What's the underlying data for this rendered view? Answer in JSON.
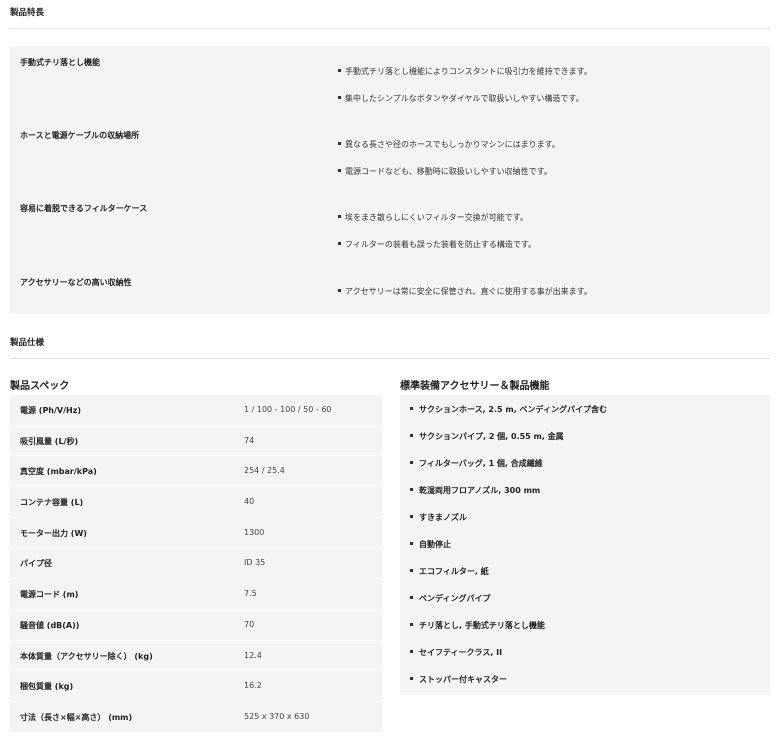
{
  "features_section": {
    "title": "製品特長",
    "items": [
      {
        "name": "手動式チリ落とし機能",
        "bullets": [
          "手動式チリ落とし機能によりコンスタントに吸引力を維持できます。",
          "集中したシンプルなボタンやダイヤルで取扱いしやすい構造です。"
        ]
      },
      {
        "name": "ホースと電源ケーブルの収納場所",
        "bullets": [
          "異なる長さや径のホースでもしっかりマシンにはまります。",
          "電源コードなども、移動時に取扱いしやすい収納性です。"
        ]
      },
      {
        "name": "容易に着脱できるフィルターケース",
        "bullets": [
          "埃をまき散らしにくいフィルター交換が可能です。",
          "フィルターの装着も誤った装着を防止する構造です。"
        ]
      },
      {
        "name": "アクセサリーなどの高い収納性",
        "bullets": [
          "アクセサリーは常に安全に保管され、直ぐに使用する事が出来ます。"
        ]
      }
    ]
  },
  "specs_section": {
    "title": "製品仕様",
    "spec_heading": "製品スペック",
    "rows": [
      {
        "label": "電源 (Ph/V/Hz)",
        "value": "1 / 100 - 100 / 50 - 60"
      },
      {
        "label": "吸引風量 (L/秒)",
        "value": "74"
      },
      {
        "label": "真空度 (mbar/kPa)",
        "value": "254 / 25.4"
      },
      {
        "label": "コンテナ容量 (L)",
        "value": "40"
      },
      {
        "label": "モーター出力 (W)",
        "value": "1300"
      },
      {
        "label": "パイプ径",
        "value": "ID 35"
      },
      {
        "label": "電源コード (m)",
        "value": "7.5"
      },
      {
        "label": "騒音値 (dB(A))",
        "value": "70"
      },
      {
        "label": "本体質量（アクセサリー除く） (kg)",
        "value": "12.4"
      },
      {
        "label": "梱包質量 (kg)",
        "value": "16.2"
      },
      {
        "label": "寸法（長さ×幅×高さ） (mm)",
        "value": "525 x 370 x 630"
      }
    ],
    "accessories_heading": "標準装備アクセサリー＆製品機能",
    "accessories": [
      "サクションホース, 2.5 m, ベンディングパイプ含む",
      "サクションパイプ, 2 個, 0.55 m, 金属",
      "フィルターバッグ, 1 個, 合成繊維",
      "乾湿両用フロアノズル, 300 mm",
      "すきまノズル",
      "自動停止",
      "エコフィルター, 紙",
      "ベンディングパイプ",
      "チリ落とし, 手動式チリ落とし機能",
      "セイフティークラス, II",
      "ストッパー付キャスター"
    ]
  }
}
